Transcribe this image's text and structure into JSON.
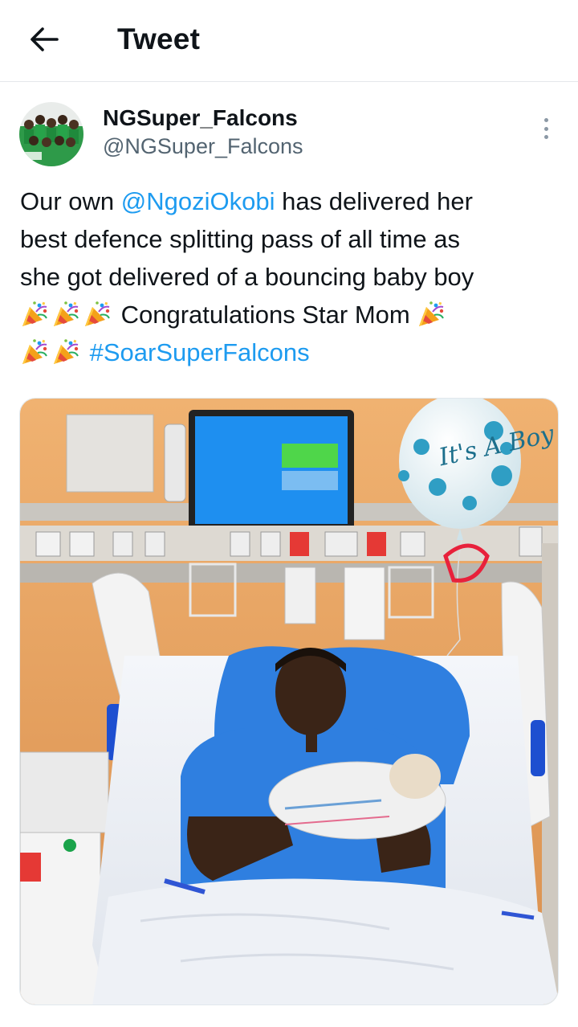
{
  "header": {
    "title": "Tweet",
    "back_icon": "arrow-left-icon"
  },
  "tweet": {
    "author": {
      "display_name": "NGSuper_Falcons",
      "handle": "@NGSuper_Falcons"
    },
    "text": {
      "line1_prefix": "Our own ",
      "mention": "@NgoziOkobi",
      "line1_suffix": " has delivered her",
      "line2": "best defence splitting pass of all time as",
      "line3": "she got delivered of a bouncing baby boy",
      "line4_text": "Congratulations Star Mom",
      "hashtag": "#SoarSuperFalcons",
      "emoji_icon": "party-popper-icon"
    },
    "media": {
      "balloon_text": "It's A Boy"
    }
  },
  "colors": {
    "link": "#1d9bf0",
    "secondary_text": "#536471",
    "primary_text": "#0f1419",
    "wall": "#e8a463",
    "gown": "#2f7fe0"
  }
}
